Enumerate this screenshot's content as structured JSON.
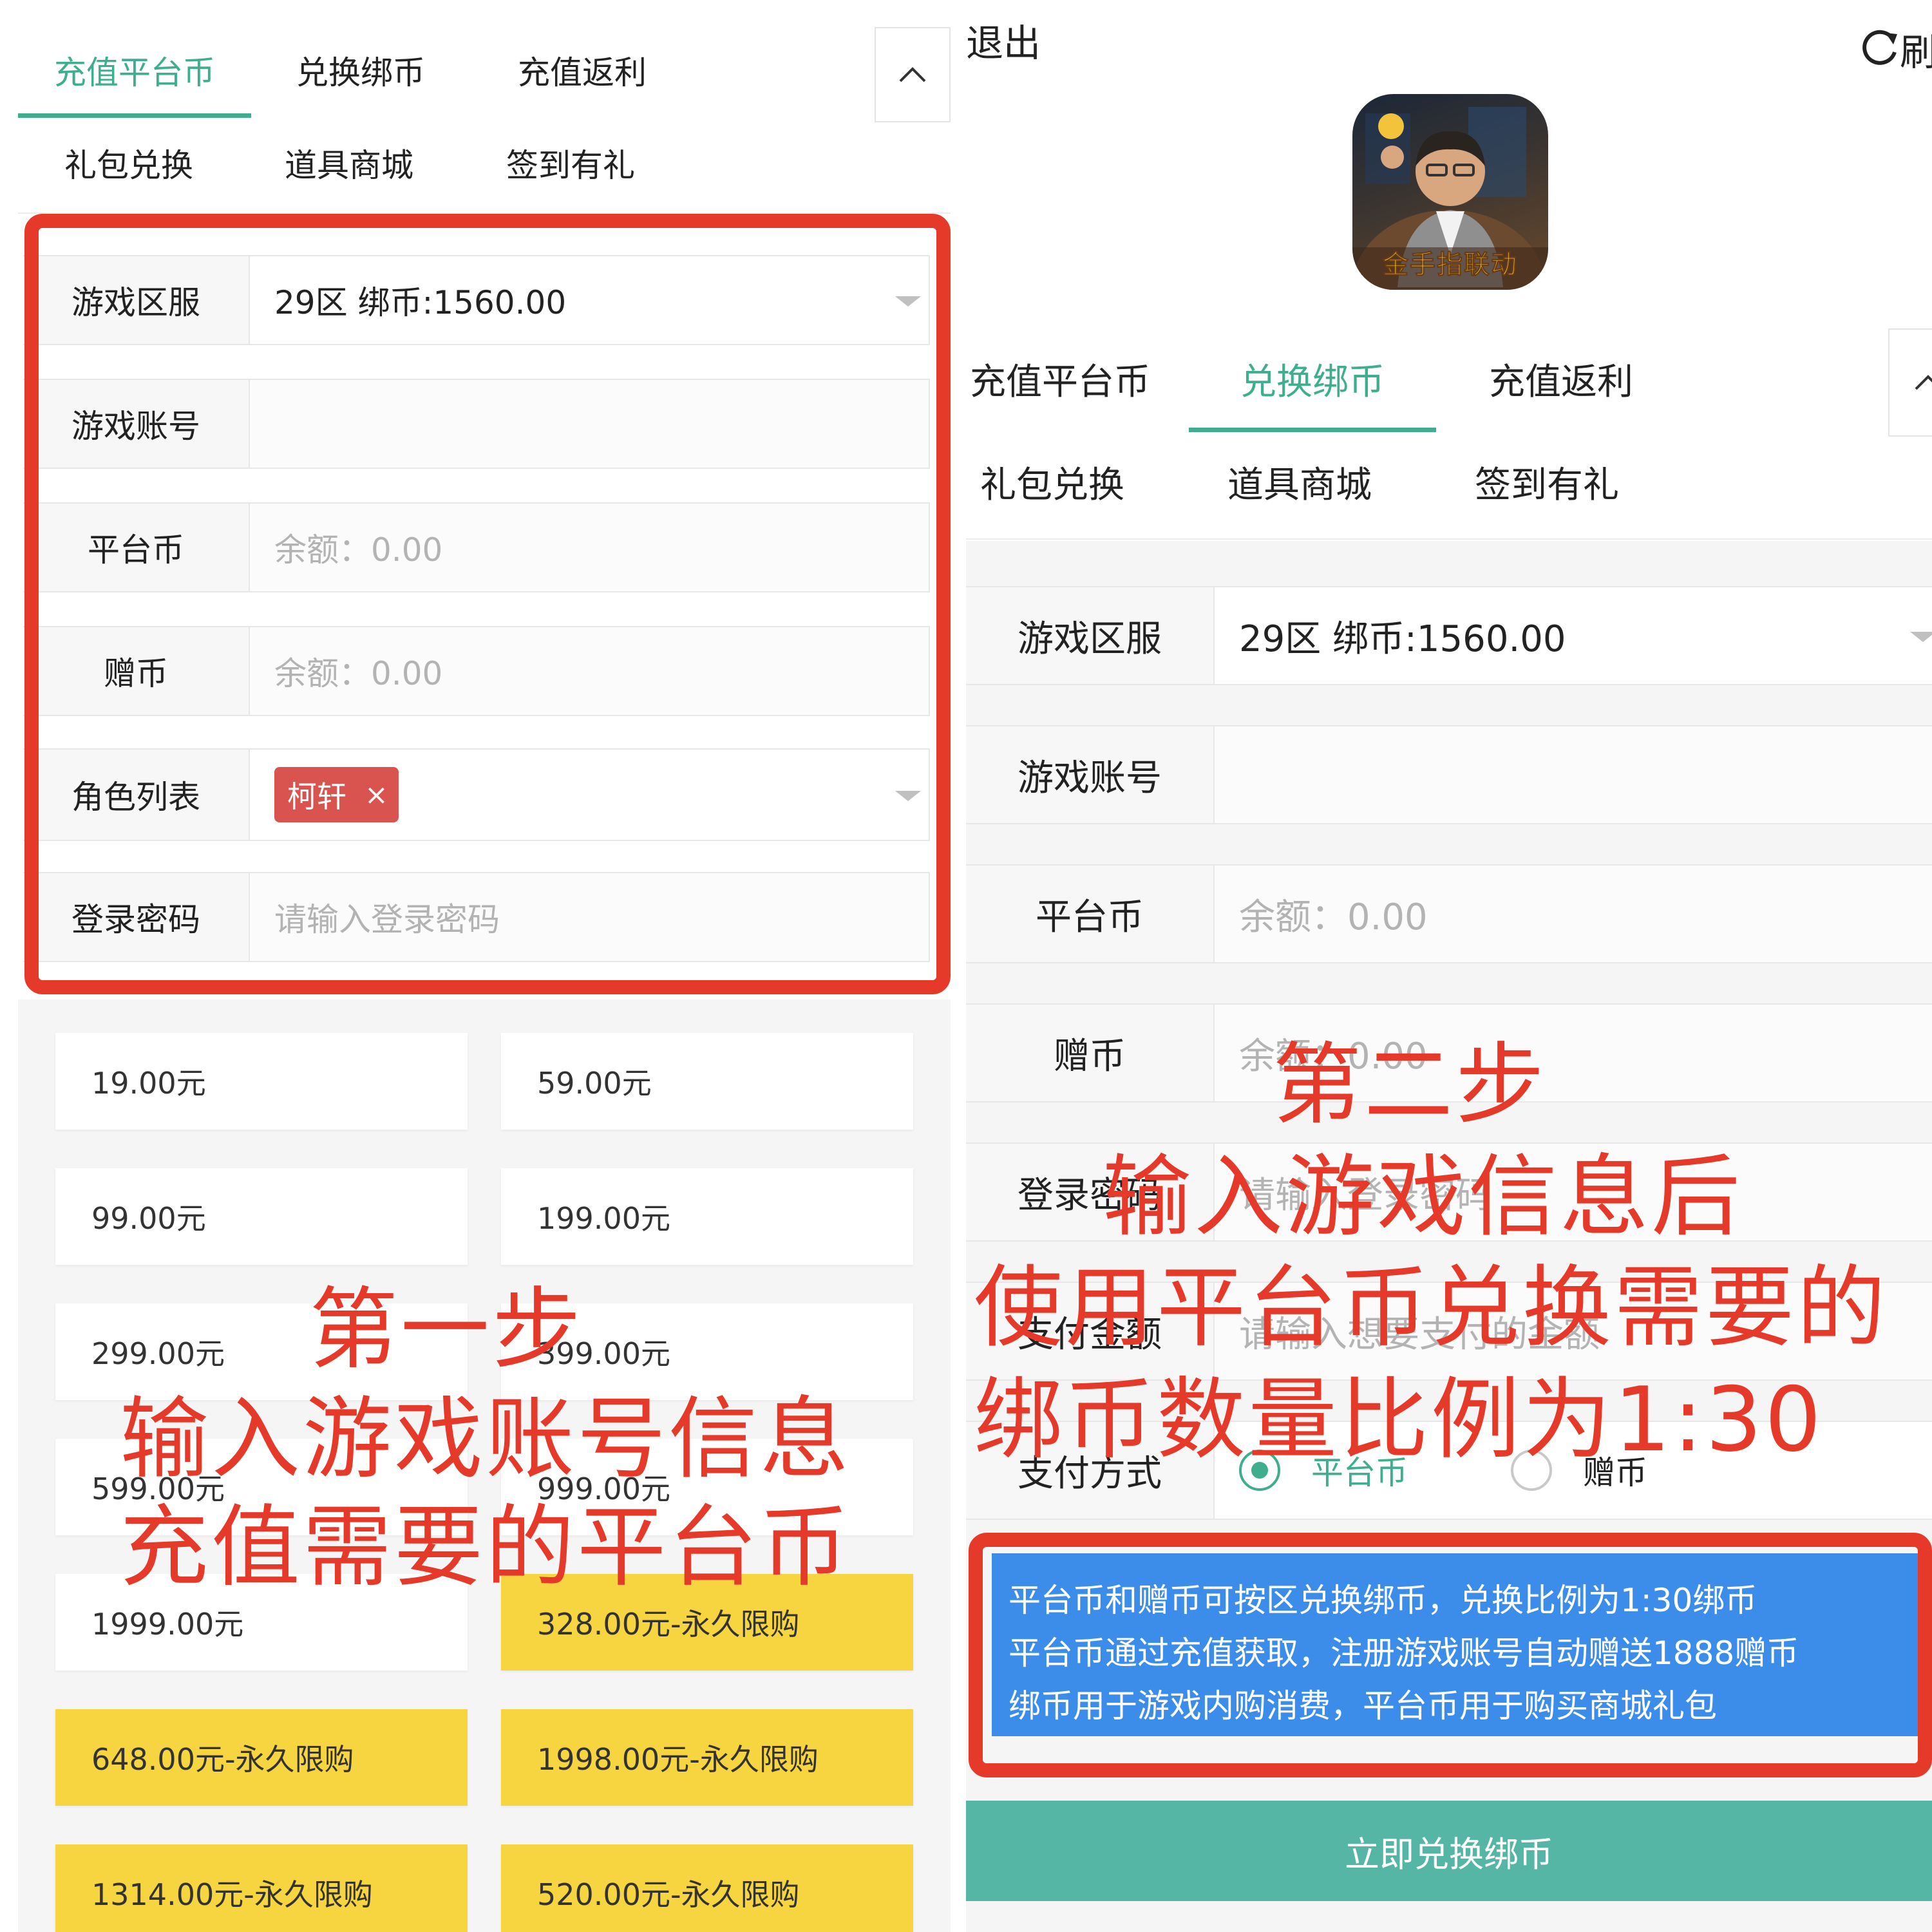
{
  "colors": {
    "accent": "#3fae8e",
    "highlight_frame": "#e5392a",
    "gold_tile": "#f6d540",
    "info_box": "#3c8dea",
    "submit_button": "#56b6a6",
    "chip": "#d9534f"
  },
  "left": {
    "tabs": [
      "充值平台币",
      "兑换绑币",
      "充值返利",
      "礼包兑换",
      "道具商城",
      "签到有礼"
    ],
    "collapse_icon": "chevron-up-icon",
    "form": {
      "server_label": "游戏区服",
      "server_value": "29区 绑币:1560.00",
      "account_label": "游戏账号",
      "platform_label": "平台币",
      "platform_value": "余额：0.00",
      "gift_label": "赠币",
      "gift_value": "余额：0.00",
      "role_label": "角色列表",
      "role_chip": "柯轩",
      "chip_close": "×",
      "password_label": "登录密码",
      "password_placeholder": "请输入登录密码"
    },
    "packages": [
      "19.00元",
      "59.00元",
      "99.00元",
      "199.00元",
      "299.00元",
      "399.00元",
      "599.00元",
      "999.00元",
      "1999.00元",
      "328.00元-永久限购",
      "648.00元-永久限购",
      "1998.00元-永久限购",
      "1314.00元-永久限购",
      "520.00元-永久限购"
    ],
    "overlay": [
      "第一步",
      "输入游戏账号信息",
      "充值需要的平台币"
    ]
  },
  "right": {
    "header": {
      "exit": "退出",
      "refresh_icon": "refresh-icon",
      "refresh": "刷"
    },
    "app_icon": {
      "name": "game-app-icon",
      "caption": "金手指联动"
    },
    "tabs": [
      "充值平台币",
      "兑换绑币",
      "充值返利",
      "礼包兑换",
      "道具商城",
      "签到有礼"
    ],
    "collapse_icon": "chevron-up-icon",
    "form": {
      "server_label": "游戏区服",
      "server_value": "29区 绑币:1560.00",
      "account_label": "游戏账号",
      "platform_label": "平台币",
      "platform_value": "余额：0.00",
      "gift_label": "赠币",
      "gift_value": "余额：0.00",
      "password_label": "登录密码",
      "password_placeholder": "请输入登录密码",
      "amount_label": "支付金额",
      "amount_placeholder": "请输入想要支付的金额",
      "method_label": "支付方式",
      "method_options": [
        "平台币",
        "赠币"
      ],
      "method_selected": 0
    },
    "info_lines": [
      "平台币和赠币可按区兑换绑币，兑换比例为1:30绑币",
      "平台币通过充值获取，注册游戏账号自动赠送1888赠币",
      "绑币用于游戏内购消费，平台币用于购买商城礼包"
    ],
    "submit": "立即兑换绑币",
    "overlay": [
      "第二步",
      "输入游戏信息后",
      "使用平台币兑换需要的",
      "绑币数量比例为1:30"
    ]
  }
}
